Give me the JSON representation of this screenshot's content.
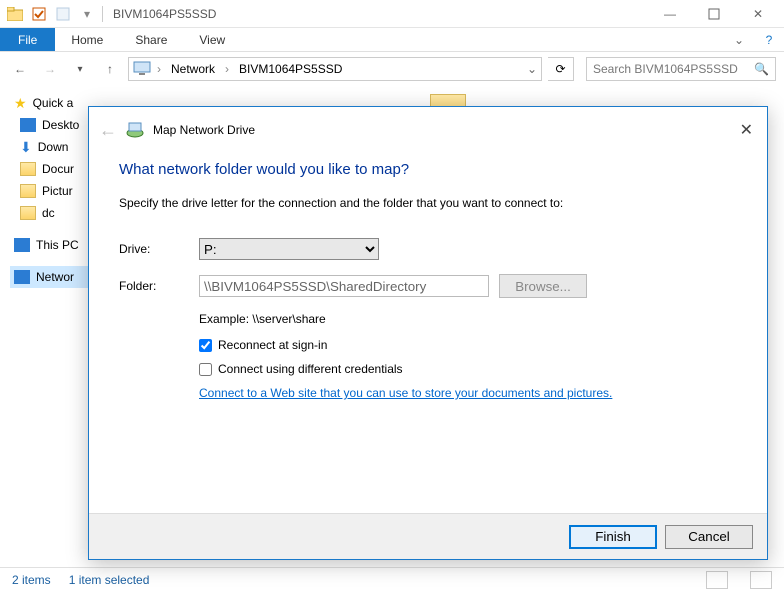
{
  "titlebar": {
    "title": "BIVM1064PS5SSD"
  },
  "ribbon": {
    "file": "File",
    "home": "Home",
    "share": "Share",
    "view": "View"
  },
  "nav": {
    "crumb1": "Network",
    "crumb2": "BIVM1064PS5SSD",
    "search_placeholder": "Search BIVM1064PS5SSD"
  },
  "sidebar": {
    "quick": "Quick a",
    "desktop": "Deskto",
    "downloads": "Down",
    "documents": "Docur",
    "pictures": "Pictur",
    "dc": "dc",
    "thispc": "This PC",
    "network": "Networ"
  },
  "status": {
    "items": "2 items",
    "selected": "1 item selected"
  },
  "dialog": {
    "title": "Map Network Drive",
    "heading": "What network folder would you like to map?",
    "sub": "Specify the drive letter for the connection and the folder that you want to connect to:",
    "drive_label": "Drive:",
    "drive_value": "P:",
    "folder_label": "Folder:",
    "folder_value": "\\\\BIVM1064PS5SSD\\SharedDirectory",
    "browse": "Browse...",
    "example": "Example: \\\\server\\share",
    "reconnect": "Reconnect at sign-in",
    "diffcred": "Connect using different credentials",
    "link": "Connect to a Web site that you can use to store your documents and pictures",
    "finish": "Finish",
    "cancel": "Cancel"
  }
}
